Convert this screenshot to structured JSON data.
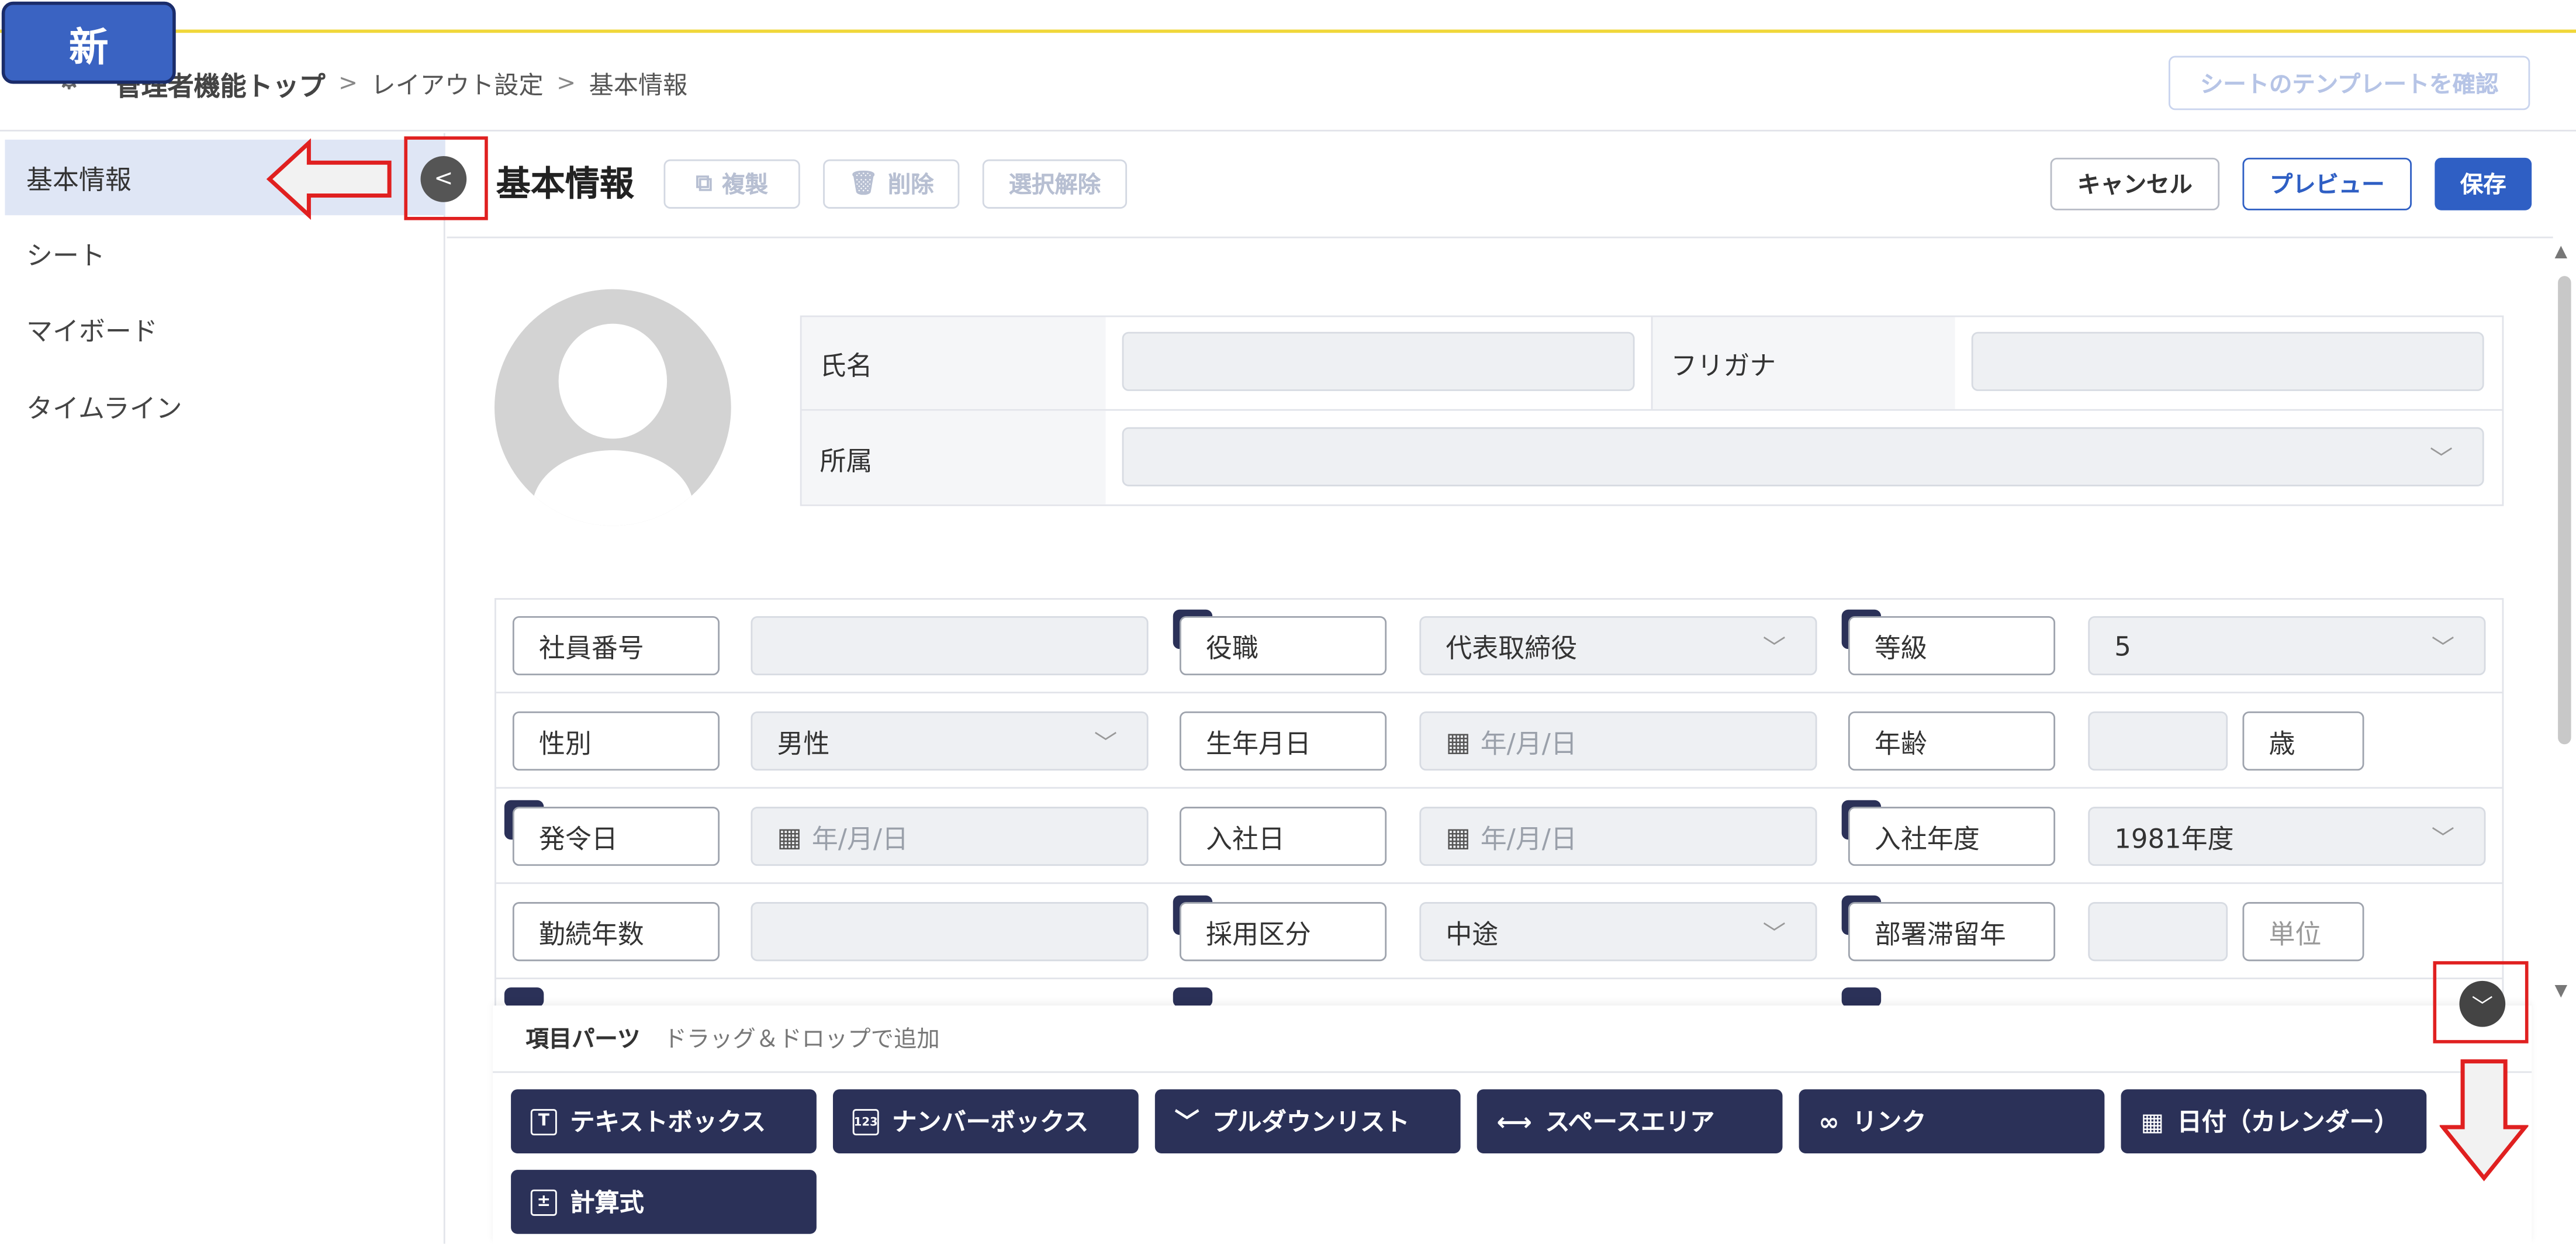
{
  "badge": {
    "label": "新"
  },
  "breadcrumb": {
    "home": "管理者機能トップ",
    "sep": ">",
    "level1": "レイアウト設定",
    "level2": "基本情報"
  },
  "header": {
    "template_button": "シートのテンプレートを確認"
  },
  "sidebar": {
    "items": [
      {
        "label": "基本情報",
        "active": true
      },
      {
        "label": "シート"
      },
      {
        "label": "マイボード"
      },
      {
        "label": "タイムライン"
      }
    ]
  },
  "toolbar": {
    "title": "基本情報",
    "copy": "複製",
    "delete": "削除",
    "deselect": "選択解除",
    "cancel": "キャンセル",
    "preview": "プレビュー",
    "save": "保存"
  },
  "profile": {
    "name_label": "氏名",
    "furigana_label": "フリガナ",
    "department_label": "所属"
  },
  "fields": {
    "employee_no": "社員番号",
    "position": "役職",
    "position_value": "代表取締役",
    "grade": "等級",
    "grade_value": "5",
    "gender": "性別",
    "gender_value": "男性",
    "birthday": "生年月日",
    "date_placeholder": "年/月/日",
    "age": "年齢",
    "age_unit": "歳",
    "issue_date": "発令日",
    "hire_date": "入社日",
    "hire_year": "入社年度",
    "hire_year_value": "1981年度",
    "years_service": "勤続年数",
    "hire_type": "採用区分",
    "hire_type_value": "中途",
    "dept_stay": "部署滞留年",
    "unit_placeholder": "単位"
  },
  "parts": {
    "title": "項目パーツ",
    "hint": "ドラッグ＆ドロップで追加",
    "items": [
      {
        "label": "テキストボックス",
        "icon": "text-icon"
      },
      {
        "label": "ナンバーボックス",
        "icon": "number-icon"
      },
      {
        "label": "プルダウンリスト",
        "icon": "chevron-down-icon"
      },
      {
        "label": "スペースエリア",
        "icon": "space-icon"
      },
      {
        "label": "リンク",
        "icon": "link-icon"
      },
      {
        "label": "日付（カレンダー）",
        "icon": "calendar-icon"
      },
      {
        "label": "計算式",
        "icon": "calculator-icon"
      }
    ]
  },
  "colors": {
    "accent": "#2f5fc4",
    "navy": "#2b3158",
    "highlight": "#e02020",
    "topline": "#f0d73a"
  }
}
